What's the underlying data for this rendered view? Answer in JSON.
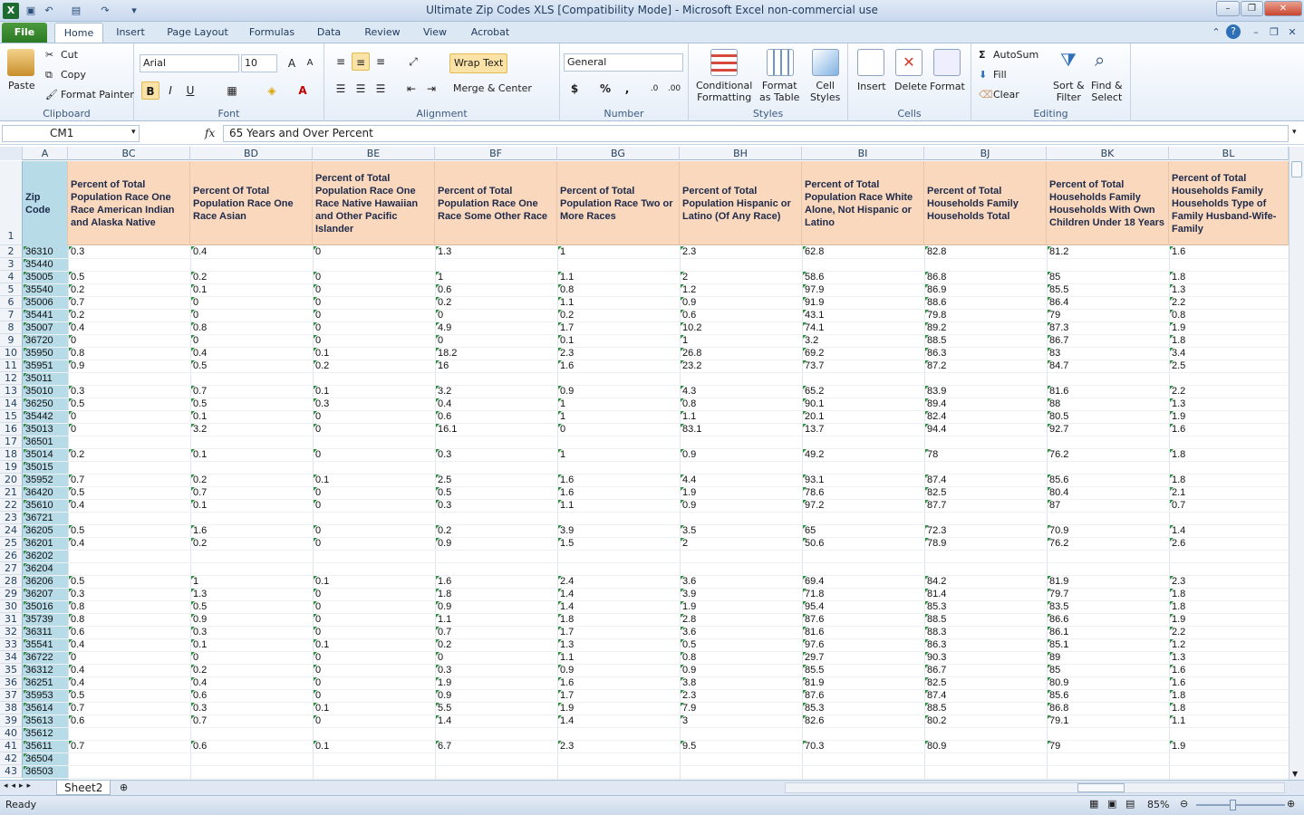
{
  "window": {
    "title": "Ultimate Zip Codes XLS  [Compatibility Mode]  -  Microsoft Excel non-commercial use"
  },
  "tabs": [
    "File",
    "Home",
    "Insert",
    "Page Layout",
    "Formulas",
    "Data",
    "Review",
    "View",
    "Acrobat"
  ],
  "active_tab": "Home",
  "ribbon": {
    "clipboard": {
      "label": "Clipboard",
      "paste": "Paste",
      "cut": "Cut",
      "copy": "Copy",
      "format_painter": "Format Painter"
    },
    "font": {
      "label": "Font",
      "font_name": "Arial",
      "font_size": "10",
      "bold": "B",
      "italic": "I",
      "underline": "U"
    },
    "alignment": {
      "label": "Alignment",
      "wrap_text": "Wrap Text",
      "merge_center": "Merge & Center"
    },
    "number": {
      "label": "Number",
      "format": "General",
      "currency": "$",
      "percent": "%",
      "comma": ","
    },
    "styles": {
      "label": "Styles",
      "conditional": "Conditional",
      "conditional2": "Formatting",
      "format_table": "Format",
      "format_table2": "as Table",
      "cell_styles": "Cell",
      "cell_styles2": "Styles"
    },
    "cells": {
      "label": "Cells",
      "insert": "Insert",
      "delete": "Delete",
      "format": "Format"
    },
    "editing": {
      "label": "Editing",
      "autosum": "AutoSum",
      "fill": "Fill",
      "clear": "Clear",
      "sort": "Sort &",
      "sort2": "Filter",
      "find": "Find &",
      "find2": "Select"
    }
  },
  "formula_bar": {
    "name_box": "CM1",
    "fx": "fx",
    "content": "65 Years and Over Percent"
  },
  "columns": [
    "A",
    "BC",
    "BD",
    "BE",
    "BF",
    "BG",
    "BH",
    "BI",
    "BJ",
    "BK",
    "BL"
  ],
  "headers": [
    "Zip Code",
    "Percent of Total Population Race One Race American Indian and Alaska Native",
    "Percent Of Total Population Race One Race Asian",
    "Percent of Total Population Race One Race Native Hawaiian and Other Pacific Islander",
    "Percent of Total Population Race One Race Some Other Race",
    "Percent of Total Population Race Two or More Races",
    "Percent of Total Population Hispanic or Latino (Of Any Race)",
    "Percent of Total Population Race White Alone, Not Hispanic or Latino",
    "Percent of Total Households Family Households Total",
    "Percent of Total Households Family Households With Own Children Under 18 Years",
    "Percent of Total Households Family Households Type of Family Husband-Wife-Family"
  ],
  "rows": [
    [
      "36310",
      "0.3",
      "0.4",
      "0",
      "1.3",
      "1",
      "2.3",
      "62.8",
      "82.8",
      "81.2",
      "1.6"
    ],
    [
      "35440",
      "",
      "",
      "",
      "",
      "",
      "",
      "",
      "",
      "",
      ""
    ],
    [
      "35005",
      "0.5",
      "0.2",
      "0",
      "1",
      "1.1",
      "2",
      "58.6",
      "86.8",
      "85",
      "1.8"
    ],
    [
      "35540",
      "0.2",
      "0.1",
      "0",
      "0.6",
      "0.8",
      "1.2",
      "97.9",
      "86.9",
      "85.5",
      "1.3"
    ],
    [
      "35006",
      "0.7",
      "0",
      "0",
      "0.2",
      "1.1",
      "0.9",
      "91.9",
      "88.6",
      "86.4",
      "2.2"
    ],
    [
      "35441",
      "0.2",
      "0",
      "0",
      "0",
      "0.2",
      "0.6",
      "43.1",
      "79.8",
      "79",
      "0.8"
    ],
    [
      "35007",
      "0.4",
      "0.8",
      "0",
      "4.9",
      "1.7",
      "10.2",
      "74.1",
      "89.2",
      "87.3",
      "1.9"
    ],
    [
      "36720",
      "0",
      "0",
      "0",
      "0",
      "0.1",
      "1",
      "3.2",
      "88.5",
      "86.7",
      "1.8"
    ],
    [
      "35950",
      "0.8",
      "0.4",
      "0.1",
      "18.2",
      "2.3",
      "26.8",
      "69.2",
      "86.3",
      "83",
      "3.4"
    ],
    [
      "35951",
      "0.9",
      "0.5",
      "0.2",
      "16",
      "1.6",
      "23.2",
      "73.7",
      "87.2",
      "84.7",
      "2.5"
    ],
    [
      "35011",
      "",
      "",
      "",
      "",
      "",
      "",
      "",
      "",
      "",
      ""
    ],
    [
      "35010",
      "0.3",
      "0.7",
      "0.1",
      "3.2",
      "0.9",
      "4.3",
      "65.2",
      "83.9",
      "81.6",
      "2.2"
    ],
    [
      "36250",
      "0.5",
      "0.5",
      "0.3",
      "0.4",
      "1",
      "0.8",
      "90.1",
      "89.4",
      "88",
      "1.3"
    ],
    [
      "35442",
      "0",
      "0.1",
      "0",
      "0.6",
      "1",
      "1.1",
      "20.1",
      "82.4",
      "80.5",
      "1.9"
    ],
    [
      "35013",
      "0",
      "3.2",
      "0",
      "16.1",
      "0",
      "83.1",
      "13.7",
      "94.4",
      "92.7",
      "1.6"
    ],
    [
      "36501",
      "",
      "",
      "",
      "",
      "",
      "",
      "",
      "",
      "",
      ""
    ],
    [
      "35014",
      "0.2",
      "0.1",
      "0",
      "0.3",
      "1",
      "0.9",
      "49.2",
      "78",
      "76.2",
      "1.8"
    ],
    [
      "35015",
      "",
      "",
      "",
      "",
      "",
      "",
      "",
      "",
      "",
      ""
    ],
    [
      "35952",
      "0.7",
      "0.2",
      "0.1",
      "2.5",
      "1.6",
      "4.4",
      "93.1",
      "87.4",
      "85.6",
      "1.8"
    ],
    [
      "36420",
      "0.5",
      "0.7",
      "0",
      "0.5",
      "1.6",
      "1.9",
      "78.6",
      "82.5",
      "80.4",
      "2.1"
    ],
    [
      "35610",
      "0.4",
      "0.1",
      "0",
      "0.3",
      "1.1",
      "0.9",
      "97.2",
      "87.7",
      "87",
      "0.7"
    ],
    [
      "36721",
      "",
      "",
      "",
      "",
      "",
      "",
      "",
      "",
      "",
      ""
    ],
    [
      "36205",
      "0.5",
      "1.6",
      "0",
      "0.2",
      "3.9",
      "3.5",
      "65",
      "72.3",
      "70.9",
      "1.4"
    ],
    [
      "36201",
      "0.4",
      "0.2",
      "0",
      "0.9",
      "1.5",
      "2",
      "50.6",
      "78.9",
      "76.2",
      "2.6"
    ],
    [
      "36202",
      "",
      "",
      "",
      "",
      "",
      "",
      "",
      "",
      "",
      ""
    ],
    [
      "36204",
      "",
      "",
      "",
      "",
      "",
      "",
      "",
      "",
      "",
      ""
    ],
    [
      "36206",
      "0.5",
      "1",
      "0.1",
      "1.6",
      "2.4",
      "3.6",
      "69.4",
      "84.2",
      "81.9",
      "2.3"
    ],
    [
      "36207",
      "0.3",
      "1.3",
      "0",
      "1.8",
      "1.4",
      "3.9",
      "71.8",
      "81.4",
      "79.7",
      "1.8"
    ],
    [
      "35016",
      "0.8",
      "0.5",
      "0",
      "0.9",
      "1.4",
      "1.9",
      "95.4",
      "85.3",
      "83.5",
      "1.8"
    ],
    [
      "35739",
      "0.8",
      "0.9",
      "0",
      "1.1",
      "1.8",
      "2.8",
      "87.6",
      "88.5",
      "86.6",
      "1.9"
    ],
    [
      "36311",
      "0.6",
      "0.3",
      "0",
      "0.7",
      "1.7",
      "3.6",
      "81.6",
      "88.3",
      "86.1",
      "2.2"
    ],
    [
      "35541",
      "0.4",
      "0.1",
      "0.1",
      "0.2",
      "1.3",
      "0.5",
      "97.6",
      "86.3",
      "85.1",
      "1.2"
    ],
    [
      "36722",
      "0",
      "0",
      "0",
      "0",
      "1.1",
      "0.8",
      "29.7",
      "90.3",
      "89",
      "1.3"
    ],
    [
      "36312",
      "0.4",
      "0.2",
      "0",
      "0.3",
      "0.9",
      "0.9",
      "85.5",
      "86.7",
      "85",
      "1.6"
    ],
    [
      "36251",
      "0.4",
      "0.4",
      "0",
      "1.9",
      "1.6",
      "3.8",
      "81.9",
      "82.5",
      "80.9",
      "1.6"
    ],
    [
      "35953",
      "0.5",
      "0.6",
      "0",
      "0.9",
      "1.7",
      "2.3",
      "87.6",
      "87.4",
      "85.6",
      "1.8"
    ],
    [
      "35614",
      "0.7",
      "0.3",
      "0.1",
      "5.5",
      "1.9",
      "7.9",
      "85.3",
      "88.5",
      "86.8",
      "1.8"
    ],
    [
      "35613",
      "0.6",
      "0.7",
      "0",
      "1.4",
      "1.4",
      "3",
      "82.6",
      "80.2",
      "79.1",
      "1.1"
    ],
    [
      "35612",
      "",
      "",
      "",
      "",
      "",
      "",
      "",
      "",
      "",
      ""
    ],
    [
      "35611",
      "0.7",
      "0.6",
      "0.1",
      "6.7",
      "2.3",
      "9.5",
      "70.3",
      "80.9",
      "79",
      "1.9"
    ],
    [
      "36504",
      "",
      "",
      "",
      "",
      "",
      "",
      "",
      "",
      "",
      ""
    ],
    [
      "36503",
      "",
      "",
      "",
      "",
      "",
      "",
      "",
      "",
      "",
      ""
    ]
  ],
  "row_numbers": [
    "1",
    "2",
    "3",
    "4",
    "5",
    "6",
    "7",
    "8",
    "9",
    "10",
    "11",
    "12",
    "13",
    "14",
    "15",
    "16",
    "17",
    "18",
    "19",
    "20",
    "21",
    "22",
    "23",
    "24",
    "25",
    "26",
    "27",
    "28",
    "29",
    "30",
    "31",
    "32",
    "33",
    "34",
    "35",
    "36",
    "37",
    "38",
    "39",
    "40",
    "41",
    "42",
    "43"
  ],
  "sheet_tab": "Sheet2",
  "status": {
    "ready": "Ready",
    "zoom": "85%"
  },
  "colors": {
    "header_fill": "#fad8bd",
    "zip_fill": "#b8dbe8",
    "excel_green": "#2b7a24"
  }
}
